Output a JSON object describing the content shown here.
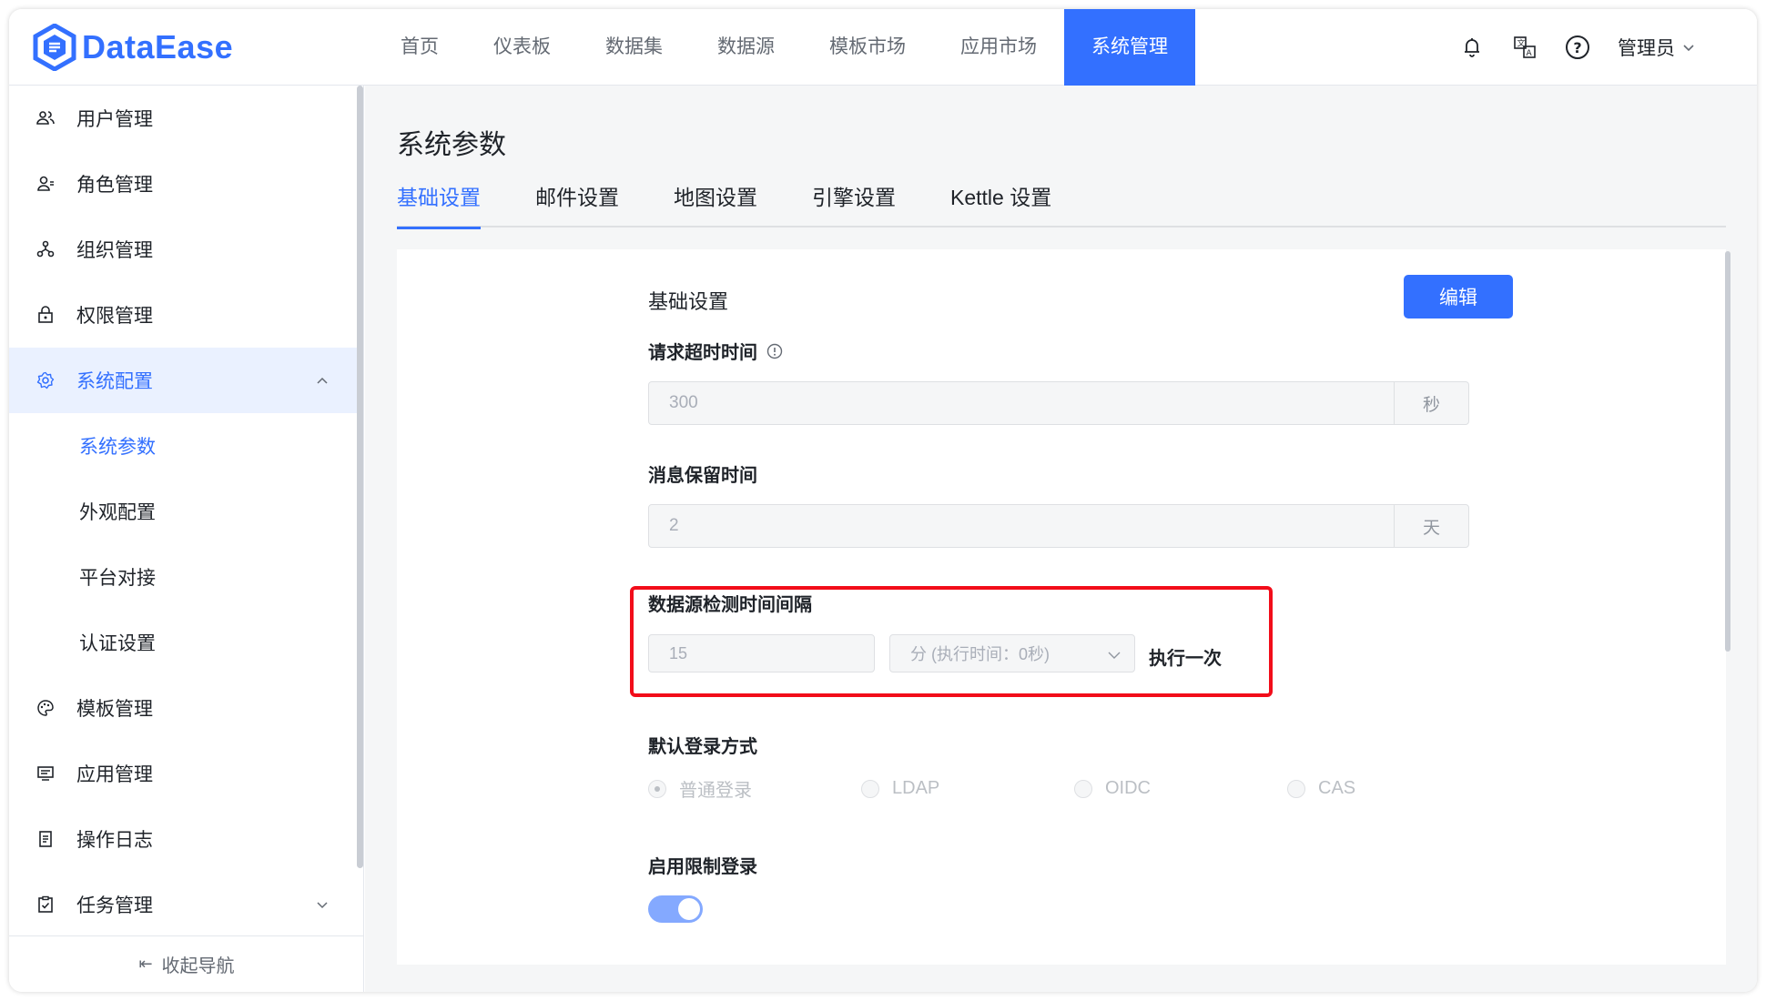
{
  "app": {
    "logo_text": "DataEase",
    "brand_color": "#3370ff"
  },
  "nav": {
    "items": [
      "首页",
      "仪表板",
      "数据集",
      "数据源",
      "模板市场",
      "应用市场",
      "系统管理"
    ],
    "active_index": 6
  },
  "header": {
    "icons": [
      "bell-icon",
      "translate-icon",
      "help-icon"
    ],
    "user_label": "管理员"
  },
  "sidebar": {
    "items": [
      {
        "label": "用户管理",
        "icon": "users-icon"
      },
      {
        "label": "角色管理",
        "icon": "role-icon"
      },
      {
        "label": "组织管理",
        "icon": "org-icon"
      },
      {
        "label": "权限管理",
        "icon": "lock-icon"
      },
      {
        "label": "系统配置",
        "icon": "gear-icon",
        "expanded": true
      },
      {
        "label": "系统参数",
        "sub": true,
        "active": true
      },
      {
        "label": "外观配置",
        "sub": true
      },
      {
        "label": "平台对接",
        "sub": true
      },
      {
        "label": "认证设置",
        "sub": true
      },
      {
        "label": "模板管理",
        "icon": "palette-icon"
      },
      {
        "label": "应用管理",
        "icon": "app-icon"
      },
      {
        "label": "操作日志",
        "icon": "log-icon"
      },
      {
        "label": "任务管理",
        "icon": "task-icon",
        "expanded": false
      }
    ],
    "collapse_label": "收起导航"
  },
  "main": {
    "page_title": "系统参数",
    "tabs": [
      "基础设置",
      "邮件设置",
      "地图设置",
      "引擎设置",
      "Kettle 设置"
    ],
    "active_tab": 0,
    "section_title": "基础设置",
    "edit_label": "编辑",
    "fields": {
      "timeout": {
        "label": "请求超时时间",
        "value": "300",
        "unit": "秒"
      },
      "retention": {
        "label": "消息保留时间",
        "value": "2",
        "unit": "天"
      },
      "ds_check": {
        "label": "数据源检测时间间隔",
        "value": "15",
        "select_value": "分 (执行时间：0秒)",
        "run_once_label": "执行一次"
      },
      "login_method": {
        "label": "默认登录方式",
        "options": [
          "普通登录",
          "LDAP",
          "OIDC",
          "CAS"
        ],
        "selected": 0
      },
      "limit_login": {
        "label": "启用限制登录",
        "enabled": true
      }
    },
    "highlight_color": "#f20d1a"
  }
}
